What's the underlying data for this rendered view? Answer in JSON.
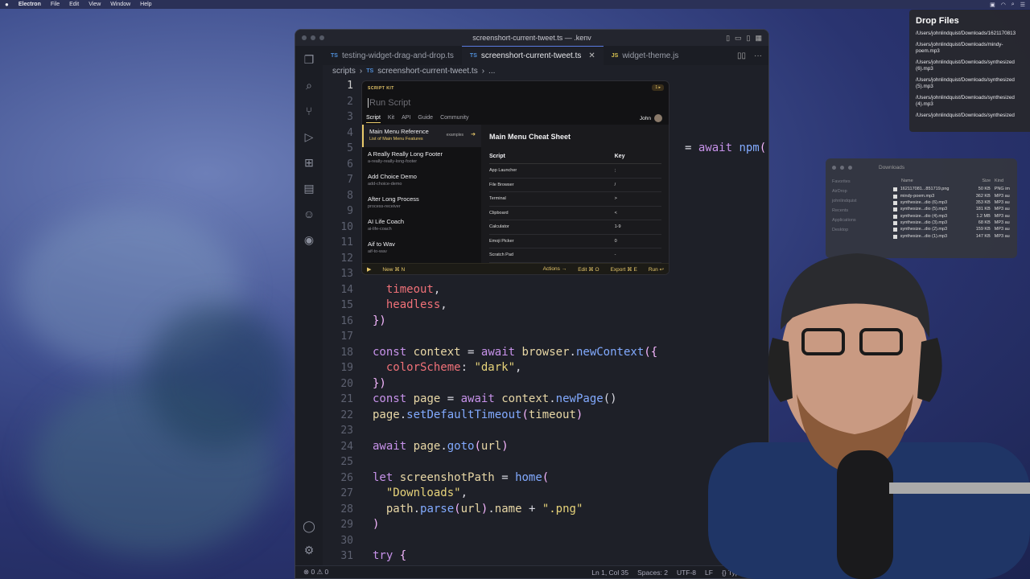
{
  "menubar": {
    "app": "Electron",
    "items": [
      "File",
      "Edit",
      "View",
      "Window",
      "Help"
    ]
  },
  "editor": {
    "window_title": "screenshort-current-tweet.ts — .kenv",
    "tabs": [
      {
        "lang": "TS",
        "label": "testing-widget-drag-and-drop.ts"
      },
      {
        "lang": "TS",
        "label": "screenshort-current-tweet.ts"
      },
      {
        "lang": "JS",
        "label": "widget-theme.js"
      }
    ],
    "breadcrumb": {
      "folder": "scripts",
      "lang": "TS",
      "file": "screenshort-current-tweet.ts",
      "rest": "..."
    },
    "code_tail": "= await npm(",
    "status": {
      "problems": "⊗ 0  ⚠ 0",
      "position": "Ln 1, Col 35",
      "spaces": "Spaces: 2",
      "encoding": "UTF-8",
      "eol": "LF",
      "language": "{} TypeScript"
    }
  },
  "script_kit": {
    "label": "SCRIPT KIT",
    "badge": "1 ▸",
    "input_placeholder": "Run Script",
    "tabs": [
      "Script",
      "Kit",
      "API",
      "Guide",
      "Community"
    ],
    "user": "John",
    "items": [
      {
        "name": "Main Menu Reference",
        "desc": "List of Main Menu Features",
        "tag": "examples"
      },
      {
        "name": "A Really Really Long Footer",
        "desc": "a-really-really-long-footer"
      },
      {
        "name": "Add Choice Demo",
        "desc": "add-choice-demo"
      },
      {
        "name": "After Long Process",
        "desc": "process-receiver"
      },
      {
        "name": "AI Life Coach",
        "desc": "ai-life-coach"
      },
      {
        "name": "Aif to Wav",
        "desc": "aif-to-wav"
      }
    ],
    "panel": {
      "title": "Main Menu Cheat Sheet",
      "col_script": "Script",
      "col_key": "Key",
      "rows": [
        [
          "App Launcher",
          ";"
        ],
        [
          "File Browser",
          "/"
        ],
        [
          "Terminal",
          ">"
        ],
        [
          "Clipboard",
          "<"
        ],
        [
          "Calculator",
          "1-9"
        ],
        [
          "Emoji Picker",
          "0"
        ],
        [
          "Scratch Pad",
          "-"
        ]
      ]
    },
    "footer": {
      "new": "New ⌘ N",
      "actions": "Actions →",
      "edit": "Edit ⌘ O",
      "export": "Export ⌘ E",
      "run": "Run ↩"
    }
  },
  "drop_files": {
    "title": "Drop Files",
    "paths": [
      "/Users/johnlindquist/Downloads/1621170813",
      "/Users/johnlindquist/Downloads/mindy-poem.mp3",
      "/Users/johnlindquist/Downloads/synthesized (6).mp3",
      "/Users/johnlindquist/Downloads/synthesized (5).mp3",
      "/Users/johnlindquist/Downloads/synthesized (4).mp3",
      "/Users/johnlindquist/Downloads/synthesized"
    ]
  },
  "finder": {
    "title": "Downloads",
    "sidebar": [
      "Favorites",
      "AirDrop",
      "johnlindquist",
      "Recents",
      "Applications",
      "Desktop"
    ],
    "headers": [
      "Name",
      "Size",
      "Kind"
    ],
    "files": [
      [
        "162117081...851719.png",
        "50 KB",
        "PNG im"
      ],
      [
        "mindy-poem.mp3",
        "362 KB",
        "MP3 au"
      ],
      [
        "synthesize...dio (6).mp3",
        "353 KB",
        "MP3 au"
      ],
      [
        "synthesize...dio (5).mp3",
        "181 KB",
        "MP3 au"
      ],
      [
        "synthesize...dio (4).mp3",
        "1.2 MB",
        "MP3 au"
      ],
      [
        "synthesize...dio (3).mp3",
        "68 KB",
        "MP3 au"
      ],
      [
        "synthesize...dio (2).mp3",
        "159 KB",
        "MP3 au"
      ],
      [
        "synthesize...dio (1).mp3",
        "147 KB",
        "MP3 au"
      ]
    ]
  }
}
